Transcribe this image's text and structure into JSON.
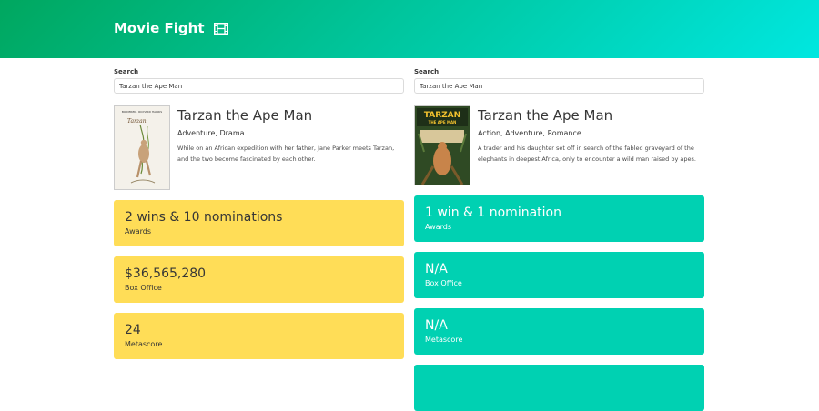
{
  "app": {
    "title": "Movie Fight",
    "logo_icon": "film-icon"
  },
  "colors": {
    "hero_start": "#00a75f",
    "hero_end": "#00e7e0",
    "winner": "#00d1b2",
    "loser": "#ffdd57"
  },
  "left": {
    "search_label": "Search",
    "search_value": "Tarzan the Ape Man",
    "movie": {
      "title": "Tarzan the Ape Man",
      "genre": "Adventure, Drama",
      "plot": "While on an African expedition with her father, Jane Parker meets Tarzan, and the two become fascinated by each other.",
      "poster_text": "BO DEREK · RICHARD HARRIS",
      "poster_title": "Tarzan"
    },
    "stats": [
      {
        "value": "2 wins & 10 nominations",
        "label": "Awards"
      },
      {
        "value": "$36,565,280",
        "label": "Box Office"
      },
      {
        "value": "24",
        "label": "Metascore"
      }
    ]
  },
  "right": {
    "search_label": "Search",
    "search_value": "Tarzan the Ape Man",
    "movie": {
      "title": "Tarzan the Ape Man",
      "genre": "Action, Adventure, Romance",
      "plot": "A trader and his daughter set off in search of the fabled graveyard of the elephants in deepest Africa, only to encounter a wild man raised by apes.",
      "poster_title": "TARZAN",
      "poster_sub": "THE APE MAN"
    },
    "stats": [
      {
        "value": "1 win & 1 nomination",
        "label": "Awards"
      },
      {
        "value": "N/A",
        "label": "Box Office"
      },
      {
        "value": "N/A",
        "label": "Metascore"
      }
    ]
  }
}
